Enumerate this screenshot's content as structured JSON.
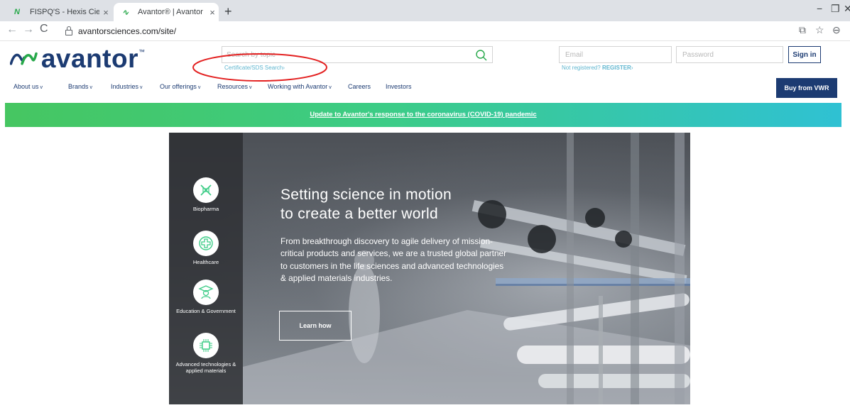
{
  "browser": {
    "tabs": [
      {
        "favicon": "N",
        "title": "FISPQ'S - Hexis Científica",
        "close": "×"
      },
      {
        "favicon": "∿",
        "title": "Avantor® | Avantor",
        "close": "×"
      }
    ],
    "new_tab": "+",
    "window_controls": {
      "minimize": "−",
      "restore": "❐",
      "close": "✕"
    },
    "address_url": "avantorsciences.com/site/",
    "nav_icons": {
      "back": "←",
      "forward": "→",
      "reload": "C",
      "translate": "⧉",
      "star": "☆",
      "profile": "⊖"
    }
  },
  "header": {
    "logo_text": "avantor",
    "logo_tm": "™",
    "search_placeholder": "Search by topic",
    "certificate_link": "Certificate/SDS Search",
    "certificate_chevron": "›",
    "email_placeholder": "Email",
    "password_placeholder": "Password",
    "signin_label": "Sign in",
    "not_registered": "Not registered?",
    "register_label": "REGISTER",
    "register_chevron": "›"
  },
  "nav": {
    "items": [
      {
        "label": "About us",
        "caret": "v"
      },
      {
        "label": "Brands",
        "caret": "v"
      },
      {
        "label": "Industries",
        "caret": "v"
      },
      {
        "label": "Our offerings",
        "caret": "v"
      },
      {
        "label": "Resources",
        "caret": "v"
      },
      {
        "label": "Working with Avantor",
        "caret": "v"
      },
      {
        "label": "Careers",
        "caret": ""
      },
      {
        "label": "Investors",
        "caret": ""
      }
    ],
    "buy_label": "Buy from VWR"
  },
  "banner": {
    "text": "Update to Avantor's response to the coronavirus (COVID-19) pandemic"
  },
  "hero": {
    "title_line_1": "Setting science in motion",
    "title_line_2": "to create a better world",
    "body": "From breakthrough discovery to agile delivery of mission-critical products and services, we are a trusted global partner to customers in the life sciences and advanced technologies & applied materials industries.",
    "button_label": "Learn how",
    "industries": [
      {
        "label": "Biopharma",
        "icon": "dna-icon"
      },
      {
        "label": "Healthcare",
        "icon": "medical-cross-icon"
      },
      {
        "label": "Education & Government",
        "icon": "graduate-icon"
      },
      {
        "label": "Advanced technologies & applied materials",
        "icon": "chip-icon"
      }
    ]
  },
  "colors": {
    "brand_navy": "#1c3b72",
    "brand_green": "#27a84a",
    "link_blue": "#5fb6cf",
    "annotation_red": "#e32020"
  }
}
